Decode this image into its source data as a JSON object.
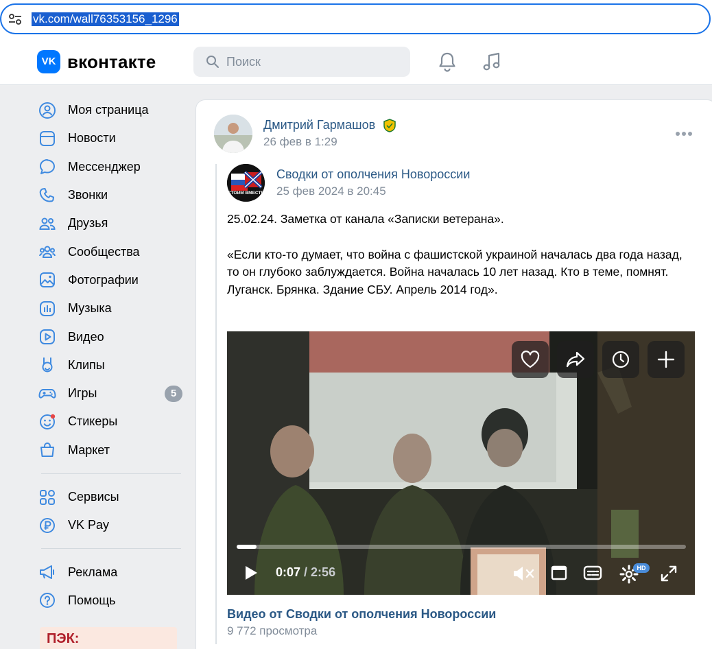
{
  "browser": {
    "url": "vk.com/wall76353156_1296"
  },
  "header": {
    "logo_text": "вконтакте",
    "search_placeholder": "Поиск",
    "icons": [
      "bell-icon",
      "music-note-icon"
    ]
  },
  "sidebar": {
    "items": [
      {
        "label": "Моя страница",
        "icon": "user-circle-icon"
      },
      {
        "label": "Новости",
        "icon": "news-icon"
      },
      {
        "label": "Мессенджер",
        "icon": "chat-bubble-icon"
      },
      {
        "label": "Звонки",
        "icon": "phone-icon"
      },
      {
        "label": "Друзья",
        "icon": "friends-icon"
      },
      {
        "label": "Сообщества",
        "icon": "communities-icon"
      },
      {
        "label": "Фотографии",
        "icon": "photo-icon"
      },
      {
        "label": "Музыка",
        "icon": "music-icon"
      },
      {
        "label": "Видео",
        "icon": "video-icon"
      },
      {
        "label": "Клипы",
        "icon": "clips-icon"
      },
      {
        "label": "Игры",
        "icon": "gamepad-icon",
        "badge": "5"
      },
      {
        "label": "Стикеры",
        "icon": "sticker-icon"
      },
      {
        "label": "Маркет",
        "icon": "market-bag-icon"
      }
    ],
    "items2": [
      {
        "label": "Сервисы",
        "icon": "services-grid-icon"
      },
      {
        "label": "VK Pay",
        "icon": "ruble-icon"
      }
    ],
    "items3": [
      {
        "label": "Реклама",
        "icon": "megaphone-icon"
      },
      {
        "label": "Помощь",
        "icon": "help-icon"
      }
    ],
    "ad_text": "ПЭК:"
  },
  "post": {
    "author": "Дмитрий Гармашов",
    "date": "26 фев в 1:29",
    "repost": {
      "source": "Сводки от ополчения Новороссии",
      "source_avatar_text": "СТОИМ ВМЕСТЕ",
      "date": "25 фев 2024 в 20:45",
      "text_line1": "25.02.24. Заметка от канала «Записки ветерана».",
      "text_line2": "«Если кто-то думает, что война с фашистской украиной началась два года назад, то он глубоко заблуждается. Война началась 10 лет назад. Кто в теме, помнят.",
      "text_line3": "Луганск. Брянка. Здание СБУ. Апрель 2014 год»."
    },
    "video": {
      "current_time": "0:07",
      "duration": "/ 2:56",
      "progress": 0.045,
      "hd_label": "HD",
      "title": "Видео от Сводки от ополчения Новороссии",
      "views": "9 772 просмотра"
    }
  }
}
